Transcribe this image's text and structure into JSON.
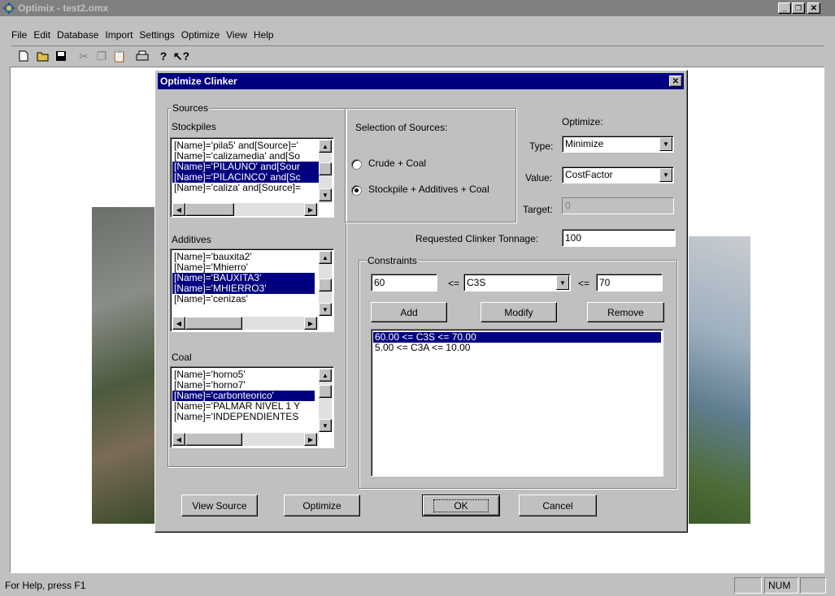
{
  "window": {
    "title": "Optimix - test2.omx"
  },
  "menu": [
    {
      "label": "File"
    },
    {
      "label": "Edit"
    },
    {
      "label": "Database"
    },
    {
      "label": "Import"
    },
    {
      "label": "Settings"
    },
    {
      "label": "Optimize"
    },
    {
      "label": "View"
    },
    {
      "label": "Help"
    }
  ],
  "toolbar": {
    "icons": [
      "new-file-icon",
      "open-folder-icon",
      "save-icon",
      "cut-icon",
      "copy-icon",
      "paste-icon",
      "print-icon",
      "help-icon",
      "context-help-icon"
    ]
  },
  "dialog": {
    "title": "Optimize Clinker",
    "sources_group": "Sources",
    "stockpiles_label": "Stockpiles",
    "stockpiles": [
      {
        "text": "[Name]='pila5' and[Source]='",
        "selected": false
      },
      {
        "text": "[Name]='calizamedia' and[So",
        "selected": false
      },
      {
        "text": "[Name]='PILAUNO' and[Sour",
        "selected": true
      },
      {
        "text": "[Name]='PILACINCO' and[Sc",
        "selected": true
      },
      {
        "text": "[Name]='caliza' and[Source]=",
        "selected": false
      }
    ],
    "additives_label": "Additives",
    "additives": [
      {
        "text": "[Name]='bauxita2'",
        "selected": false
      },
      {
        "text": "[Name]='Mhierro'",
        "selected": false
      },
      {
        "text": "[Name]='BAUXITA3'",
        "selected": true
      },
      {
        "text": "[Name]='MHIERRO3'",
        "selected": true
      },
      {
        "text": "[Name]='cenizas'",
        "selected": false
      }
    ],
    "coal_label": "Coal",
    "coal": [
      {
        "text": "[Name]='horno5'",
        "selected": false
      },
      {
        "text": "[Name]='horno7'",
        "selected": false
      },
      {
        "text": "[Name]='carbonteorico'",
        "selected": true
      },
      {
        "text": "[Name]='PALMAR NIVEL 1 Y",
        "selected": false
      },
      {
        "text": "[Name]='INDEPENDIENTES",
        "selected": false
      }
    ],
    "selection_label": "Selection of Sources:",
    "radio_crude": "Crude + Coal",
    "radio_stockpile": "Stockpile + Additives + Coal",
    "radio_selected": "stockpile",
    "optimize_label": "Optimize:",
    "type_label": "Type:",
    "type_value": "Minimize",
    "value_label": "Value:",
    "value_value": "CostFactor",
    "target_label": "Target:",
    "target_value": "0",
    "tonnage_label": "Requested Clinker Tonnage:",
    "tonnage_value": "100",
    "constraints_group": "Constraints",
    "constraint_min": "60",
    "constraint_op1": "<=",
    "constraint_var": "C3S",
    "constraint_op2": "<=",
    "constraint_max": "70",
    "add_button": "Add",
    "modify_button": "Modify",
    "remove_button": "Remove",
    "constraints": [
      {
        "text": "60.00 <= C3S <= 70.00",
        "selected": true
      },
      {
        "text": "5.00 <= C3A <= 10.00",
        "selected": false
      }
    ],
    "view_source_button": "View Source",
    "optimize_button": "Optimize",
    "ok_button": "OK",
    "cancel_button": "Cancel"
  },
  "status": {
    "help": "For Help, press F1",
    "num": "NUM"
  },
  "colors": {
    "titlebar_inactive": "#808080",
    "dialog_title": "#000080",
    "selection": "#000080"
  }
}
